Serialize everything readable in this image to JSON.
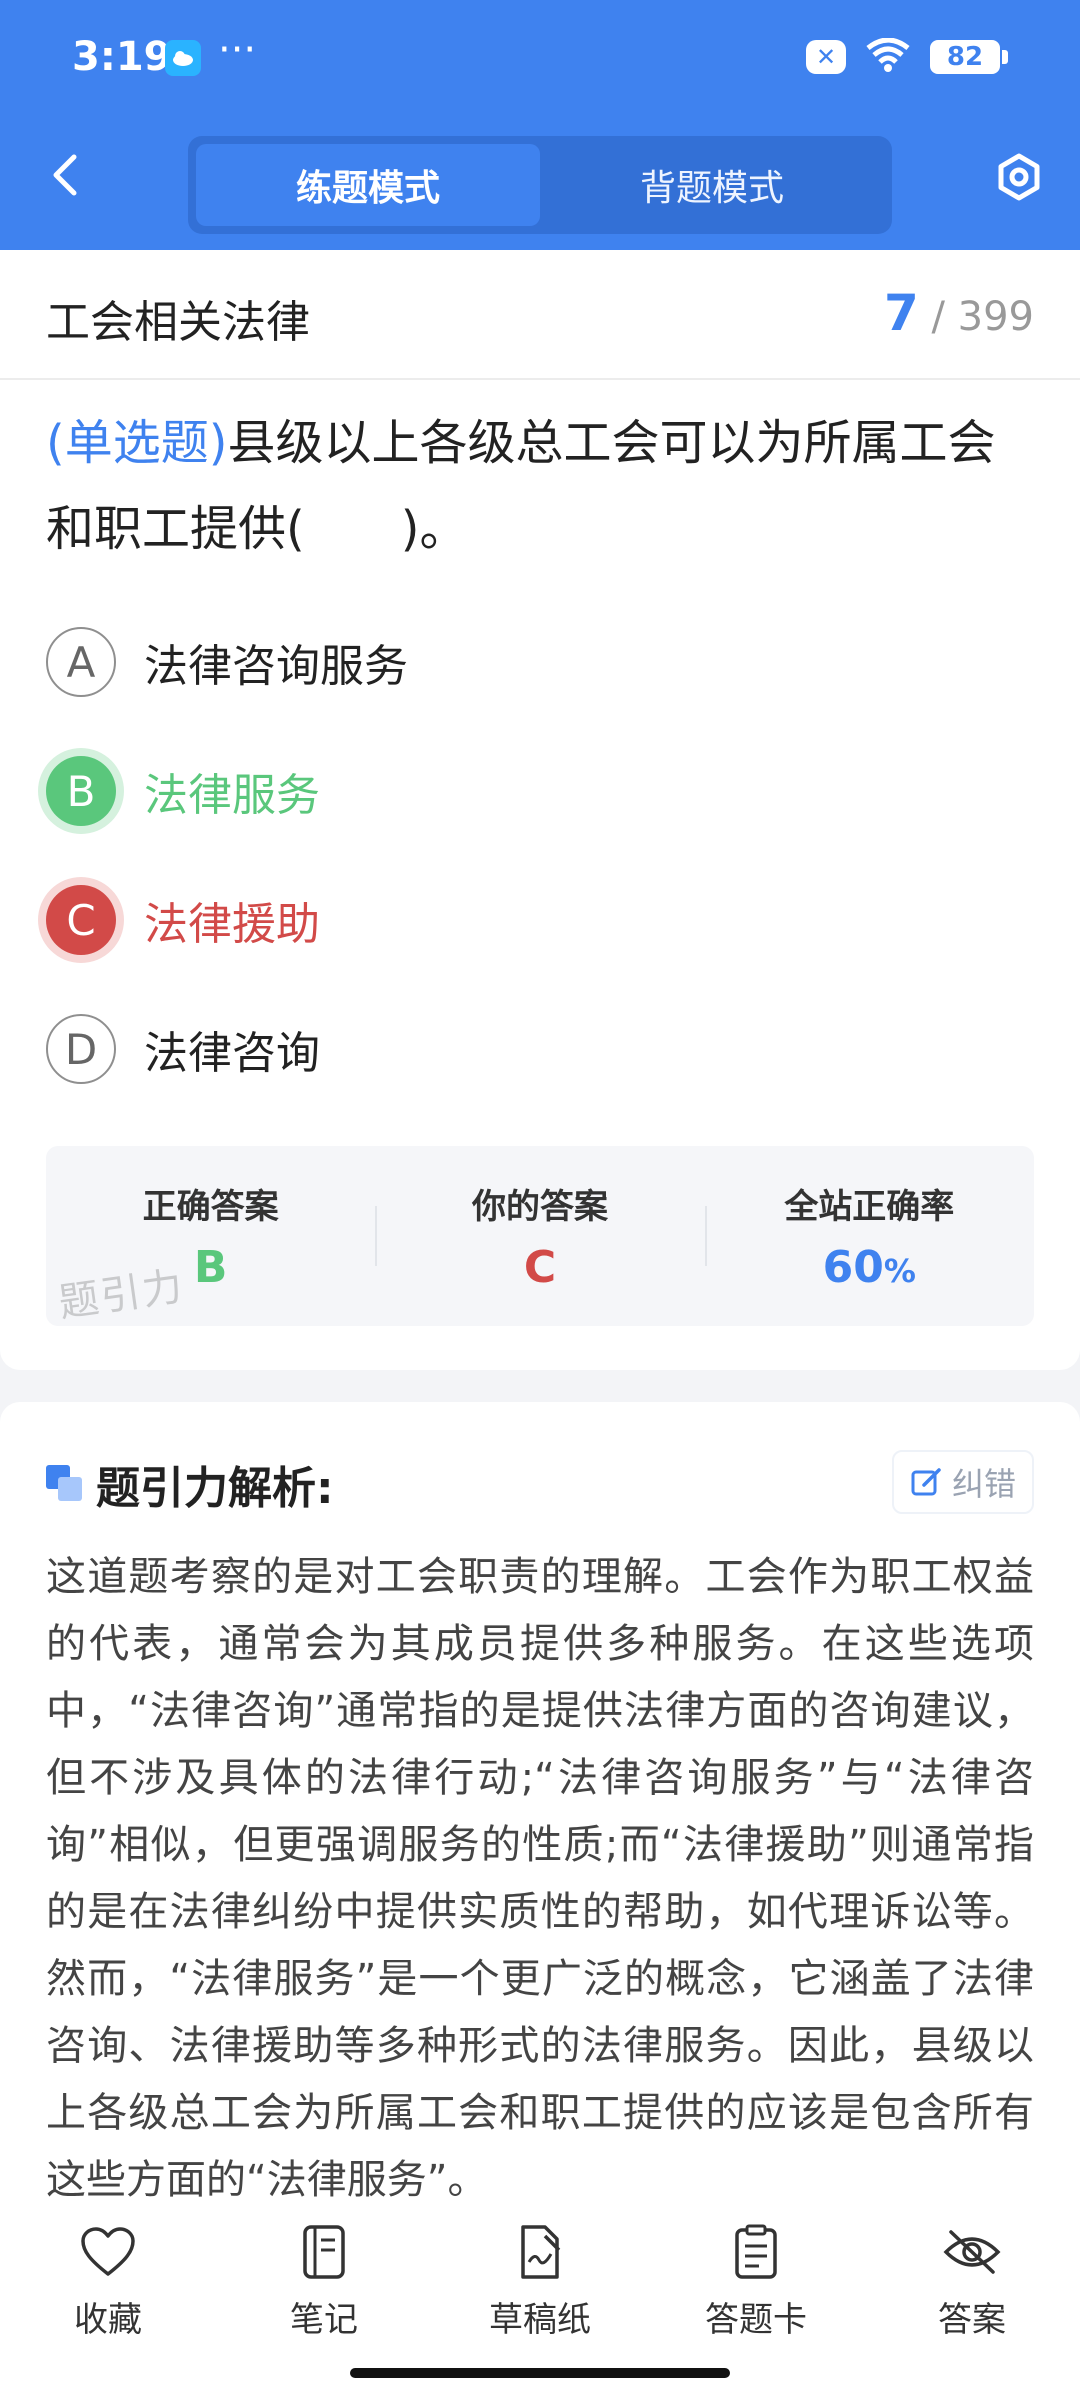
{
  "status_bar": {
    "time": "3:19",
    "more": "···",
    "battery": "82"
  },
  "header": {
    "tabs": [
      {
        "label": "练题模式",
        "active": true
      },
      {
        "label": "背题模式",
        "active": false
      }
    ],
    "accent_color": "#3f82ef"
  },
  "question": {
    "section": "工会相关法律",
    "current": "7",
    "total": "/ 399",
    "type": "(单选题)",
    "text": "县级以上各级总工会可以为所属工会和职工提供(　　)。",
    "options": [
      {
        "letter": "A",
        "text": "法律咨询服务",
        "state": "normal"
      },
      {
        "letter": "B",
        "text": "法律服务",
        "state": "correct"
      },
      {
        "letter": "C",
        "text": "法律援助",
        "state": "wrong"
      },
      {
        "letter": "D",
        "text": "法律咨询",
        "state": "normal"
      }
    ]
  },
  "answer_summary": {
    "correct_label": "正确答案",
    "correct_value": "B",
    "yours_label": "你的答案",
    "yours_value": "C",
    "rate_label": "全站正确率",
    "rate_value": "60",
    "rate_unit": "%",
    "watermark": "题引力"
  },
  "analysis": {
    "title": "题引力解析:",
    "report_label": "纠错",
    "text": "这道题考察的是对工会职责的理解。工会作为职工权益的代表，通常会为其成员提供多种服务。在这些选项中，“法律咨询”通常指的是提供法律方面的咨询建议，但不涉及具体的法律行动;“法律咨询服务”与“法律咨询”相似，但更强调服务的性质;而“法律援助”则通常指的是在法律纠纷中提供实质性的帮助，如代理诉讼等。然而，“法律服务”是一个更广泛的概念，它涵盖了法律咨询、法律援助等多种形式的法律服务。因此，县级以上各级总工会为所属工会和职工提供的应该是包含所有这些方面的“法律服务”。"
  },
  "bottom_bar": {
    "items": [
      {
        "label": "收藏",
        "icon": "heart-icon"
      },
      {
        "label": "笔记",
        "icon": "notebook-icon"
      },
      {
        "label": "草稿纸",
        "icon": "draft-icon"
      },
      {
        "label": "答题卡",
        "icon": "answer-card-icon"
      },
      {
        "label": "答案",
        "icon": "eye-off-icon"
      }
    ]
  }
}
